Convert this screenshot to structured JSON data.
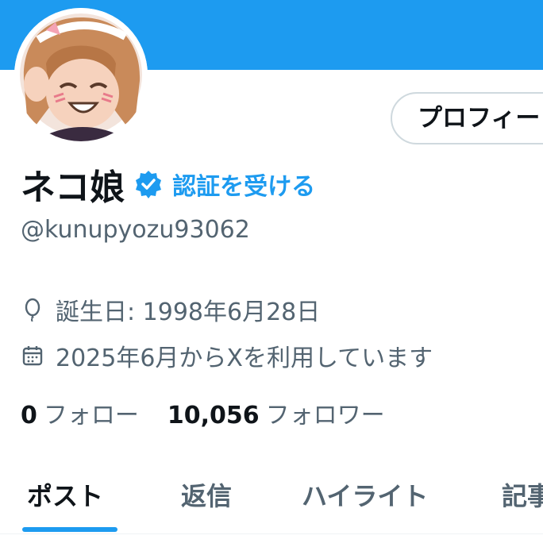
{
  "profile": {
    "edit_profile_label": "プロフィー",
    "display_name": "ネコ娘",
    "get_verified_label": "認証を受ける",
    "handle": "@kunupyozu93062",
    "birthday_text": "誕生日: 1998年6月28日",
    "joined_text": "2025年6月からXを利用しています",
    "following_count": "0",
    "following_label": "フォロー",
    "followers_count": "10,056",
    "followers_label": "フォロワー"
  },
  "tabs": [
    {
      "label": "ポスト",
      "active": true
    },
    {
      "label": "返信",
      "active": false
    },
    {
      "label": "ハイライト",
      "active": false
    },
    {
      "label": "記事",
      "active": false
    }
  ],
  "icons": {
    "verified": "verified-badge-icon",
    "birthday": "balloon-icon",
    "joined": "calendar-icon"
  },
  "colors": {
    "banner": "#1d9bf0",
    "accent": "#1d9bf0",
    "text_primary": "#0f1419",
    "text_secondary": "#536471"
  }
}
